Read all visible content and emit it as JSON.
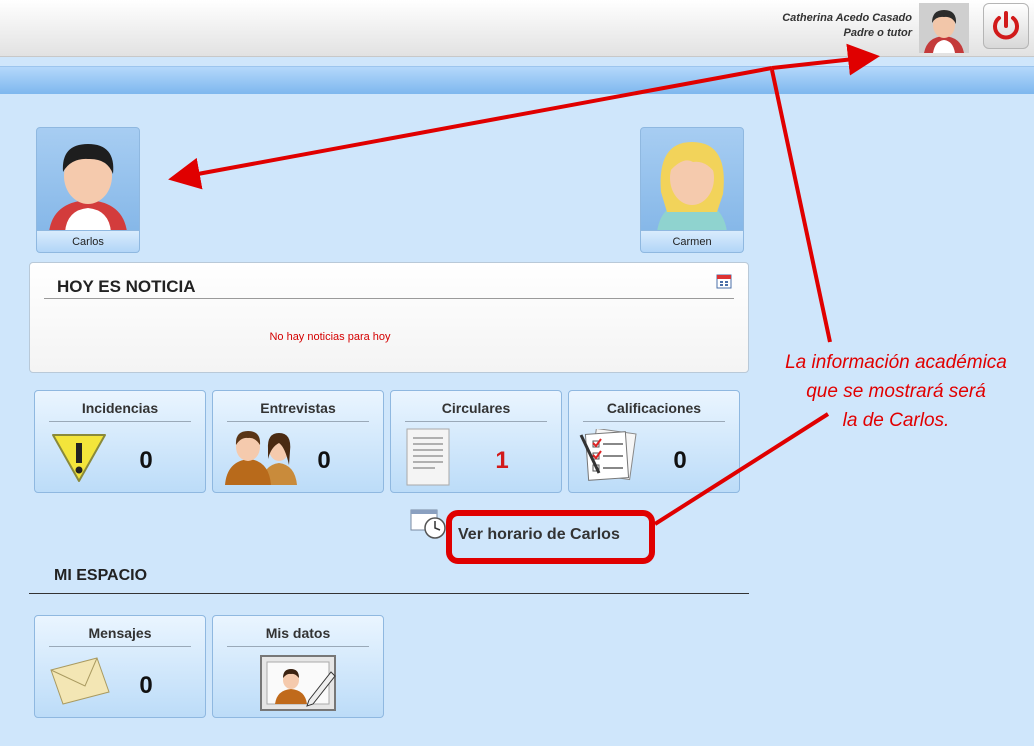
{
  "header": {
    "user_name": "Catherina Acedo Casado",
    "user_role": "Padre o tutor"
  },
  "children": [
    {
      "name": "Carlos"
    },
    {
      "name": "Carmen"
    }
  ],
  "news": {
    "title": "HOY ES NOTICIA",
    "empty_message": "No hay noticias para hoy"
  },
  "tiles": [
    {
      "label": "Incidencias",
      "count": "0",
      "icon": "warning-icon"
    },
    {
      "label": "Entrevistas",
      "count": "0",
      "icon": "people-icon"
    },
    {
      "label": "Circulares",
      "count": "1",
      "icon": "document-icon"
    },
    {
      "label": "Calificaciones",
      "count": "0",
      "icon": "grades-icon"
    }
  ],
  "schedule": {
    "label": "Ver horario de Carlos"
  },
  "my_space": {
    "title": "MI ESPACIO",
    "tiles": [
      {
        "label": "Mensajes",
        "count": "0",
        "icon": "envelope-icon"
      },
      {
        "label": "Mis datos",
        "icon": "profile-edit-icon"
      }
    ]
  },
  "annotation": {
    "lines": [
      "La información académica",
      "que se mostrará será",
      "la de Carlos."
    ]
  },
  "colors": {
    "accent_red": "#e00000",
    "tile_blue": "#bcdcf8"
  }
}
